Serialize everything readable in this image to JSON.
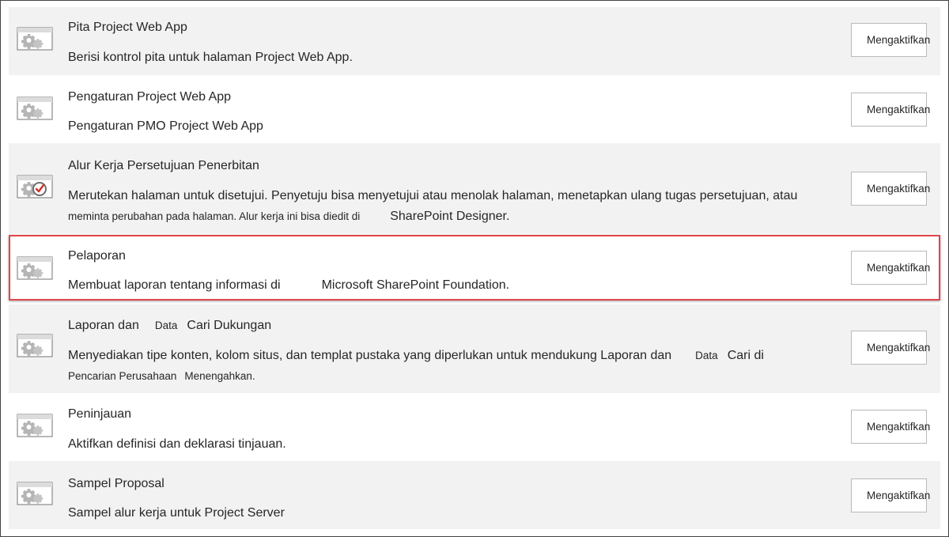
{
  "features": [
    {
      "title": "Pita Project Web App",
      "description": "Berisi kontrol pita untuk halaman Project Web App.",
      "icon": "gear-feature-icon",
      "button_label": "Mengaktifkan"
    },
    {
      "title": "Pengaturan Project Web App",
      "description": "Pengaturan PMO Project Web App",
      "icon": "gear-feature-icon",
      "button_label": "Mengaktifkan"
    },
    {
      "title": "Alur Kerja Persetujuan Penerbitan",
      "description_line1": "Merutekan halaman untuk disetujui. Penyetuju bisa menyetujui atau menolak halaman, menetapkan ulang tugas persetujuan, atau",
      "description_line2_part1": "meminta perubahan pada halaman. Alur kerja ini bisa diedit di",
      "description_line2_part2": "SharePoint Designer.",
      "icon": "approval-workflow-icon",
      "button_label": "Mengaktifkan"
    },
    {
      "title": "Pelaporan",
      "description_part1": "Membuat laporan tentang informasi di",
      "description_part2": "Microsoft SharePoint Foundation.",
      "icon": "gear-feature-icon",
      "button_label": "Mengaktifkan",
      "highlighted": true
    },
    {
      "title_part1": "Laporan dan",
      "title_part2": "Data",
      "title_part3": "Cari Dukungan",
      "description_line1_part1": "Menyediakan tipe konten, kolom situs, dan templat pustaka yang diperlukan untuk mendukung Laporan dan",
      "description_line1_part2": "Data",
      "description_line1_part3": "Cari di",
      "description_line2_part1": "Pencarian Perusahaan",
      "description_line2_part2": "Menengahkan.",
      "icon": "gear-feature-icon",
      "button_label": "Mengaktifkan"
    },
    {
      "title": "Peninjauan",
      "description": "Aktifkan definisi dan deklarasi tinjauan.",
      "icon": "gear-feature-icon",
      "button_label": "Mengaktifkan"
    },
    {
      "title": "Sampel Proposal",
      "description": "Sampel alur kerja untuk Project Server",
      "icon": "gear-feature-icon",
      "button_label": "Mengaktifkan"
    }
  ],
  "colors": {
    "row_shaded": "#f2f2f2",
    "highlight_border": "#e0464a",
    "text": "#262626"
  }
}
